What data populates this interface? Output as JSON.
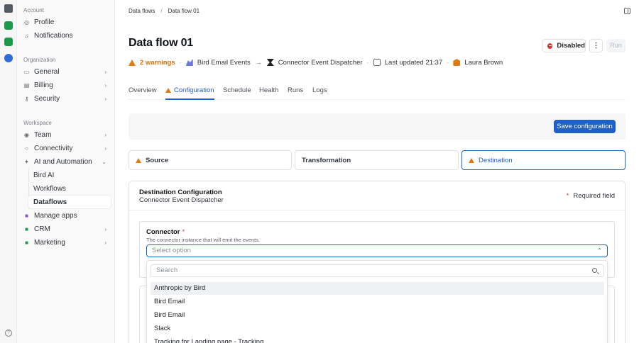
{
  "sidebar": {
    "sections": {
      "account": "Account",
      "organization": "Organization",
      "workspace": "Workspace"
    },
    "items": {
      "profile": "Profile",
      "notifications": "Notifications",
      "general": "General",
      "billing": "Billing",
      "security": "Security",
      "team": "Team",
      "connectivity": "Connectivity",
      "ai_automation": "AI and Automation",
      "bird_ai": "Bird AI",
      "workflows": "Workflows",
      "dataflows": "Dataflows",
      "manage_apps": "Manage apps",
      "crm": "CRM",
      "marketing": "Marketing"
    }
  },
  "breadcrumb": {
    "root": "Data flows",
    "sep": "/",
    "current": "Data flow 01"
  },
  "header": {
    "title": "Data flow 01",
    "status_label": "Disabled",
    "more_label": "⋮",
    "run_label": "Run"
  },
  "meta": {
    "warnings": "2 warnings",
    "source": "Bird Email Events",
    "arrow": "→",
    "destination": "Connector Event Dispatcher",
    "updated": "Last updated 21:37",
    "owner": "Laura Brown",
    "dot": "·"
  },
  "tabs": [
    "Overview",
    "Configuration",
    "Schedule",
    "Health",
    "Runs",
    "Logs"
  ],
  "actions": {
    "save_label": "Save configuration"
  },
  "steps": {
    "source": "Source",
    "transformation": "Transformation",
    "destination": "Destination"
  },
  "card": {
    "title": "Destination Configuration",
    "subtitle": "Connector Event Dispatcher",
    "required_star": "*",
    "required_label": "Required field"
  },
  "connector_field": {
    "label": "Connector",
    "star": "*",
    "help": "The connector instance that will emit the events.",
    "placeholder": "Select option"
  },
  "dropdown": {
    "search_placeholder": "Search",
    "options": [
      "Anthropic by Bird",
      "Bird Email",
      "Bird Email",
      "Slack",
      "Tracking for Landing page - Tracking"
    ]
  },
  "colors": {
    "accent": "#1f5fc9",
    "warning": "#e07b14",
    "danger": "#e03232"
  }
}
